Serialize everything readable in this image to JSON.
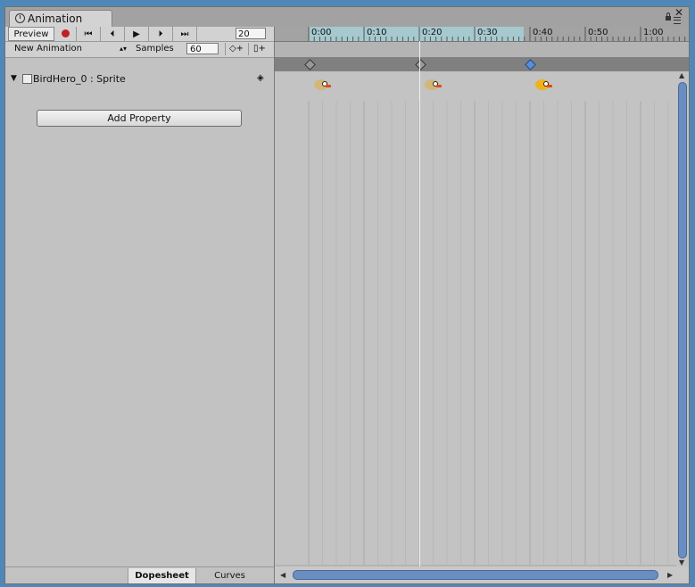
{
  "window": {
    "tab_title": "Animation",
    "close_glyph": "✕"
  },
  "toolbar": {
    "preview_label": "Preview",
    "record_icon": "record-icon",
    "first_glyph": "⏮",
    "prev_glyph": "⏴",
    "play_glyph": "▶",
    "next_glyph": "⏵",
    "last_glyph": "⏭",
    "frame_value": "20",
    "clip_name": "New Animation",
    "clip_arrow": "▴▾",
    "samples_label": "Samples",
    "samples_value": "60",
    "add_keyframe_glyph": "◇+",
    "add_event_glyph": "▯+"
  },
  "properties": [
    {
      "toggle_glyph": "▼",
      "name": "BirdHero_0 : Sprite",
      "key_glyph": "◈"
    }
  ],
  "add_property_label": "Add Property",
  "view_tabs": {
    "dopesheet": "Dopesheet",
    "curves": "Curves"
  },
  "timeline": {
    "ticks": [
      "0:00",
      "0:10",
      "0:20",
      "0:30",
      "0:40",
      "0:50",
      "1:00"
    ],
    "keyframes": [
      {
        "selected": false
      },
      {
        "selected": false
      },
      {
        "selected": true
      }
    ]
  },
  "scroll": {
    "left_arrow": "◀",
    "right_arrow": "▶",
    "up_arrow": "▲",
    "down_arrow": "▼"
  },
  "colors": {
    "range": "#a6c9cf",
    "record": "#c12020",
    "selected_key": "#5a8fd8",
    "scroll_thumb": "#6a8ec0"
  }
}
